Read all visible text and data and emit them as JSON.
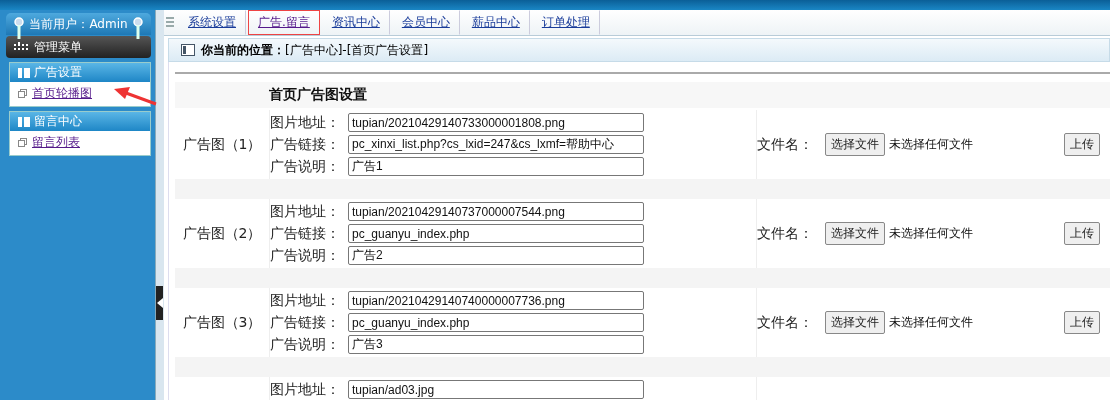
{
  "user_panel": {
    "label": "当前用户：Admin"
  },
  "menu_title": "管理菜单",
  "sidebar": {
    "sections": [
      {
        "title": "广告设置",
        "items": [
          {
            "label": "首页轮播图"
          }
        ]
      },
      {
        "title": "留言中心",
        "items": [
          {
            "label": "留言列表"
          }
        ]
      }
    ]
  },
  "nav_tabs": [
    {
      "label": "系统设置",
      "selected": false
    },
    {
      "label": "广告.留言",
      "selected": true
    },
    {
      "label": "资讯中心",
      "selected": false
    },
    {
      "label": "会员中心",
      "selected": false
    },
    {
      "label": "薪品中心",
      "selected": false
    },
    {
      "label": "订单处理",
      "selected": false
    }
  ],
  "breadcrumb": "**你当前的位置：**[广告中心]-[首页广告设置]",
  "table": {
    "title": "首页广告图设置",
    "rows": [
      {
        "name": "广告图（1）",
        "fields": [
          {
            "label": "图片地址：",
            "value": "tupian/20210429140733000001808.png"
          },
          {
            "label": "广告链接：",
            "value": "pc_xinxi_list.php?cs_lxid=247&cs_lxmf=帮助中心"
          },
          {
            "label": "广告说明：",
            "value": "广告1"
          }
        ],
        "file": {
          "label": "文件名：",
          "choose_button": "选择文件",
          "status": "未选择任何文件",
          "upload_button": "上传"
        }
      },
      {
        "name": "广告图（2）",
        "fields": [
          {
            "label": "图片地址：",
            "value": "tupian/20210429140737000007544.png"
          },
          {
            "label": "广告链接：",
            "value": "pc_guanyu_index.php"
          },
          {
            "label": "广告说明：",
            "value": "广告2"
          }
        ],
        "file": {
          "label": "文件名：",
          "choose_button": "选择文件",
          "status": "未选择任何文件",
          "upload_button": "上传"
        }
      },
      {
        "name": "广告图（3）",
        "fields": [
          {
            "label": "图片地址：",
            "value": "tupian/20210429140740000007736.png"
          },
          {
            "label": "广告链接：",
            "value": "pc_guanyu_index.php"
          },
          {
            "label": "广告说明：",
            "value": "广告3"
          }
        ],
        "file": {
          "label": "文件名：",
          "choose_button": "选择文件",
          "status": "未选择任何文件",
          "upload_button": "上传"
        }
      },
      {
        "fields": [
          {
            "label": "图片地址：",
            "value": "tupian/ad03.jpg"
          }
        ]
      }
    ]
  }
}
